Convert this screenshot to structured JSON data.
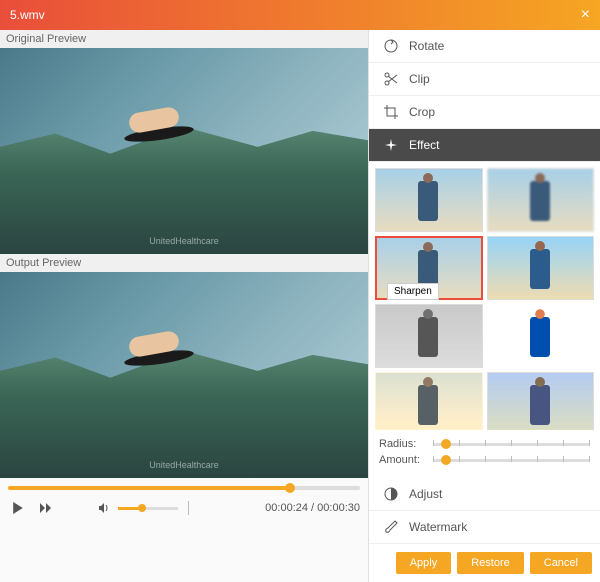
{
  "titlebar": {
    "filename": "5.wmv"
  },
  "previews": {
    "original_label": "Original Preview",
    "output_label": "Output Preview",
    "watermark": "UnitedHealthcare"
  },
  "playback": {
    "current_time": "00:00:24",
    "total_time": "00:00:30"
  },
  "tabs": {
    "rotate": "Rotate",
    "clip": "Clip",
    "crop": "Crop",
    "effect": "Effect",
    "adjust": "Adjust",
    "watermark": "Watermark"
  },
  "effects": {
    "selected_tooltip": "Sharpen",
    "radius_label": "Radius:",
    "amount_label": "Amount:"
  },
  "buttons": {
    "apply": "Apply",
    "restore": "Restore",
    "cancel": "Cancel"
  }
}
